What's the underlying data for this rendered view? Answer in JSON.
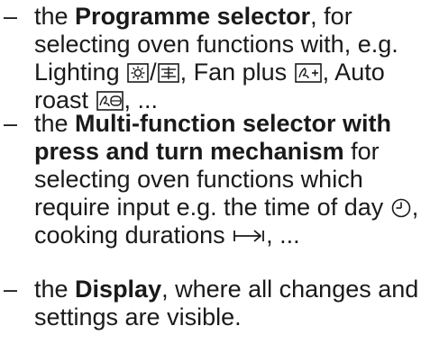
{
  "items": [
    {
      "dash": "–",
      "lines": {
        "l1_pre": "the ",
        "l1_bold": "Programme selector",
        "l1_post": ", for",
        "l2": "selecting oven functions with, e.g.",
        "l3_pre": "Lighting ",
        "l3_sep": "/",
        "l3_mid": ", Fan plus ",
        "l3_post": ", Auto",
        "l4_pre": "roast ",
        "l4_post": ", ..."
      },
      "icons": [
        "lighting-icon",
        "lighting-alt-icon",
        "fan-plus-icon",
        "auto-roast-icon"
      ]
    },
    {
      "dash": "–",
      "lines": {
        "l1_pre": "the ",
        "l1_bold": "Multi-function selector with",
        "l2_bold": "press and turn mechanism",
        "l2_post": " for",
        "l3": "selecting oven functions which",
        "l4_pre": "require input e.g. the time of day ",
        "l4_post": ",",
        "l5_pre": "cooking durations ",
        "l5_post": ", ..."
      },
      "icons": [
        "clock-icon",
        "duration-icon"
      ]
    },
    {
      "dash": "–",
      "lines": {
        "l1_pre": "the ",
        "l1_bold": "Display",
        "l1_post": ", where all changes and",
        "l2": "settings are visible."
      }
    }
  ]
}
